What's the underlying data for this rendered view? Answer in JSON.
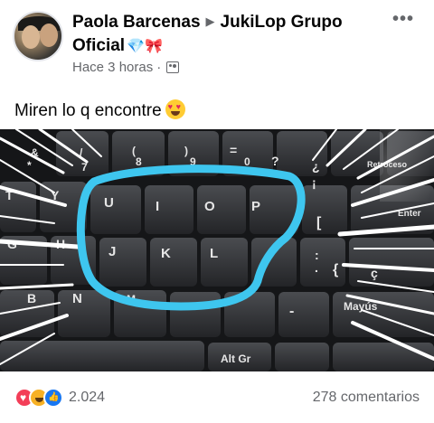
{
  "post": {
    "author": "Paola Barcenas",
    "group": "JukiLop Grupo Oficial",
    "badge_icons": "💎🎀",
    "timestamp": "Hace 3 horas",
    "separator": "·",
    "more_label": "•••",
    "text": "Miren lo q encontre",
    "text_emoji": "heart-eyes-emoji"
  },
  "photo": {
    "keys": [
      "U",
      "I",
      "O",
      "P",
      "J",
      "K",
      "L",
      "N",
      "M",
      "Alt Gr",
      "Mayús",
      "Retroceso",
      "Enter",
      "?",
      "¿",
      "¡",
      "[",
      "{",
      "ç",
      "T",
      "Y",
      "G",
      "H",
      "7",
      "8",
      "9",
      "0",
      "=",
      "&",
      "/",
      "(",
      ")",
      "-",
      ".",
      ":",
      "*",
      "B"
    ],
    "highlight_color": "#3ec6ef"
  },
  "footer": {
    "reaction_count": "2.024",
    "comments_label": "278 comentarios"
  },
  "colors": {
    "secondary_text": "#65676b",
    "love": "#f33e58",
    "haha": "#f7b125",
    "like": "#1877f2"
  }
}
